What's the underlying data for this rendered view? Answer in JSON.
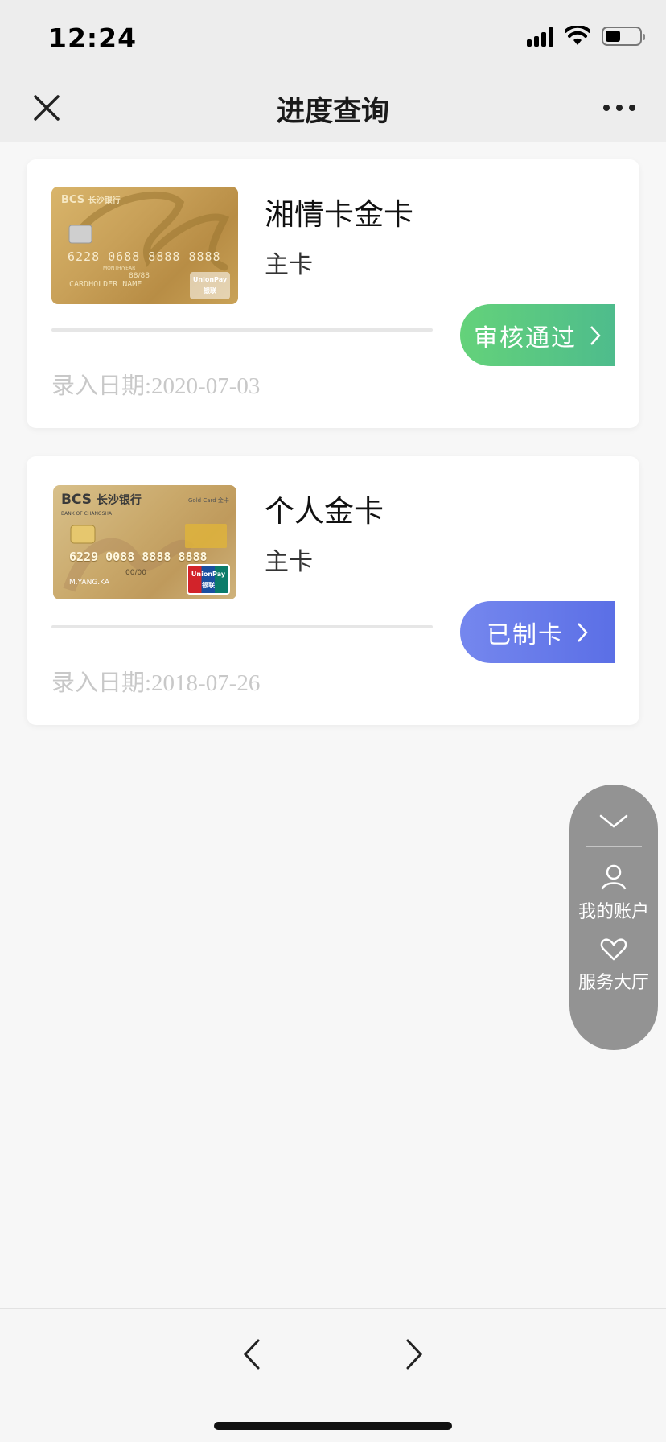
{
  "status_bar": {
    "time": "12:24",
    "battery_level": 0.45
  },
  "nav": {
    "title": "进度查询",
    "close_icon": "close-icon",
    "more_icon": "more-icon"
  },
  "cards": [
    {
      "name": "湘情卡金卡",
      "type": "主卡",
      "date": "录入日期:2020-07-03",
      "status": "审核通过",
      "status_color_start": "#64d27a",
      "status_color_end": "#4ebc8c",
      "image": {
        "brand": "BCS",
        "bank": "长沙银行",
        "number": "6228 0688 8888 8888",
        "valid_label": "MONTH/YEAR",
        "valid": "88/88",
        "holder": "CARDHOLDER NAME",
        "network": "UnionPay",
        "network_cn": "银联"
      }
    },
    {
      "name": "个人金卡",
      "type": "主卡",
      "date": "录入日期:2018-07-26",
      "status": "已制卡",
      "status_color_start": "#7587ee",
      "status_color_end": "#5b6fe6",
      "image": {
        "brand": "BCS",
        "bank": "长沙银行",
        "bank_en": "BANK OF CHANGSHA",
        "gold_label": "Gold Card 金卡",
        "number": "6229 0088 8888 8888",
        "valid": "00/00",
        "holder": "M.YANG.KA",
        "network": "UnionPay",
        "network_cn": "银联"
      }
    }
  ],
  "float_panel": {
    "items": [
      {
        "label": "我的账户",
        "icon": "user-icon"
      },
      {
        "label": "服务大厅",
        "icon": "heart-icon"
      }
    ]
  },
  "bottom_bar": {
    "back_icon": "chevron-left-icon",
    "forward_icon": "chevron-right-icon"
  }
}
